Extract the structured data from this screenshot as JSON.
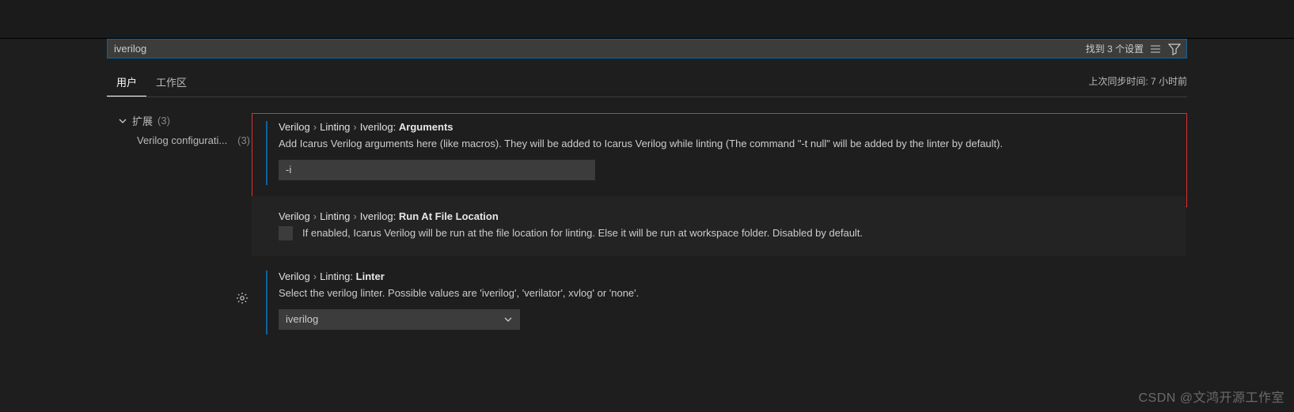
{
  "search": {
    "value": "iverilog",
    "resultText": "找到 3 个设置"
  },
  "tabs": {
    "user": "用户",
    "workspace": "工作区"
  },
  "syncTime": "上次同步时间: 7 小时前",
  "sidebar": {
    "groupLabel": "扩展",
    "groupCount": "(3)",
    "itemLabel": "Verilog configurati...",
    "itemCount": "(3)"
  },
  "settings": {
    "arguments": {
      "path1": "Verilog",
      "path2": "Linting",
      "path3": "Iverilog:",
      "leaf": "Arguments",
      "desc": "Add Icarus Verilog arguments here (like macros). They will be added to Icarus Verilog while linting (The command \"-t null\" will be added by the linter by default).",
      "value": "-i"
    },
    "runAtFileLocation": {
      "path1": "Verilog",
      "path2": "Linting",
      "path3": "Iverilog:",
      "leaf": "Run At File Location",
      "desc": "If enabled, Icarus Verilog will be run at the file location for linting. Else it will be run at workspace folder. Disabled by default."
    },
    "linter": {
      "path1": "Verilog",
      "path2": "Linting:",
      "leaf": "Linter",
      "desc": "Select the verilog linter. Possible values are 'iverilog', 'verilator', xvlog' or 'none'.",
      "value": "iverilog"
    }
  },
  "watermark": "CSDN @文鸿开源工作室"
}
